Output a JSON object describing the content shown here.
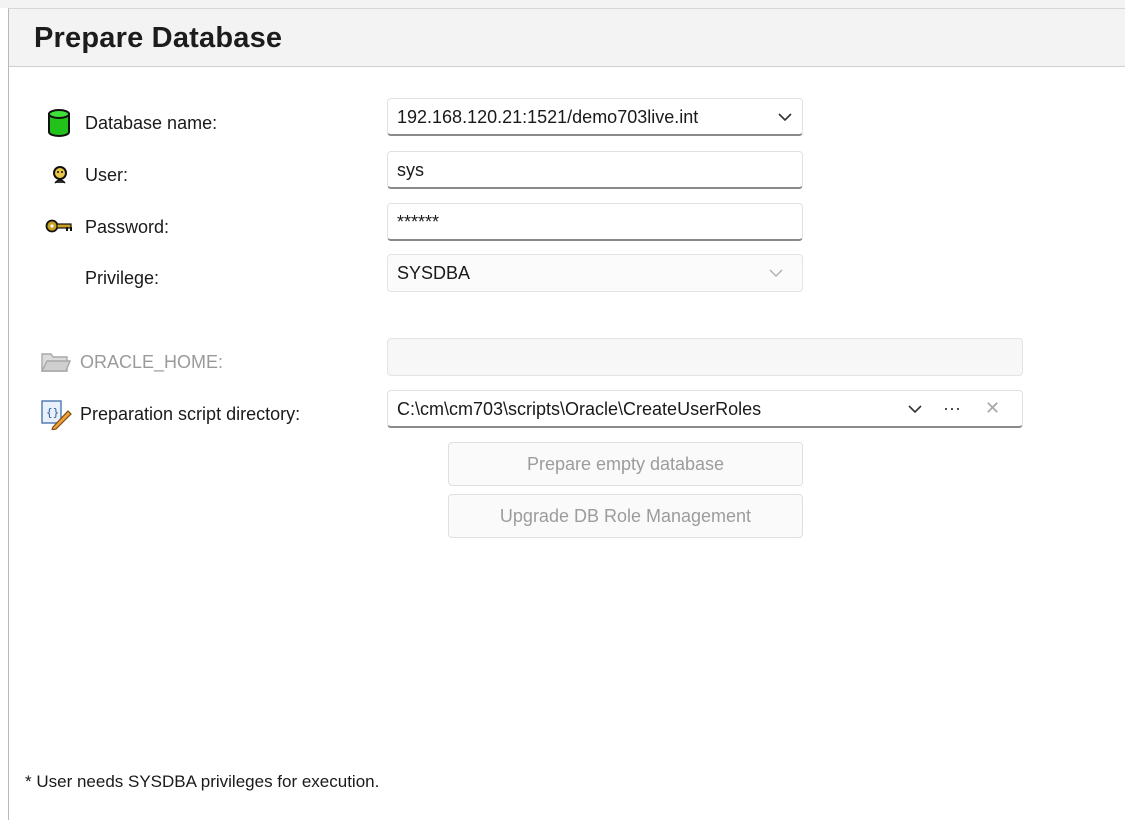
{
  "header": {
    "title": "Prepare Database"
  },
  "form": {
    "database_name": {
      "label": "Database name:",
      "value": "192.168.120.21:1521/demo703live.int",
      "icon": "database-icon"
    },
    "user": {
      "label": "User:",
      "value": "sys",
      "icon": "user-icon"
    },
    "password": {
      "label": "Password:",
      "value": "******",
      "icon": "key-icon"
    },
    "privilege": {
      "label": "Privilege:",
      "value": "SYSDBA"
    },
    "oracle_home": {
      "label": "ORACLE_HOME:",
      "value": "",
      "icon": "folder-icon"
    },
    "script_dir": {
      "label": "Preparation script directory:",
      "value": "C:\\cm\\cm703\\scripts\\Oracle\\CreateUserRoles",
      "icon": "script-edit-icon",
      "more_label": "···",
      "clear_label": "✕"
    }
  },
  "buttons": {
    "prepare_empty": "Prepare empty database",
    "upgrade_role": "Upgrade DB Role Management"
  },
  "footnote": "* User needs SYSDBA privileges for execution.",
  "colors": {
    "database_icon": "#22c21a",
    "key_icon": "#c9a020",
    "disabled_text": "#9c9c9c"
  }
}
